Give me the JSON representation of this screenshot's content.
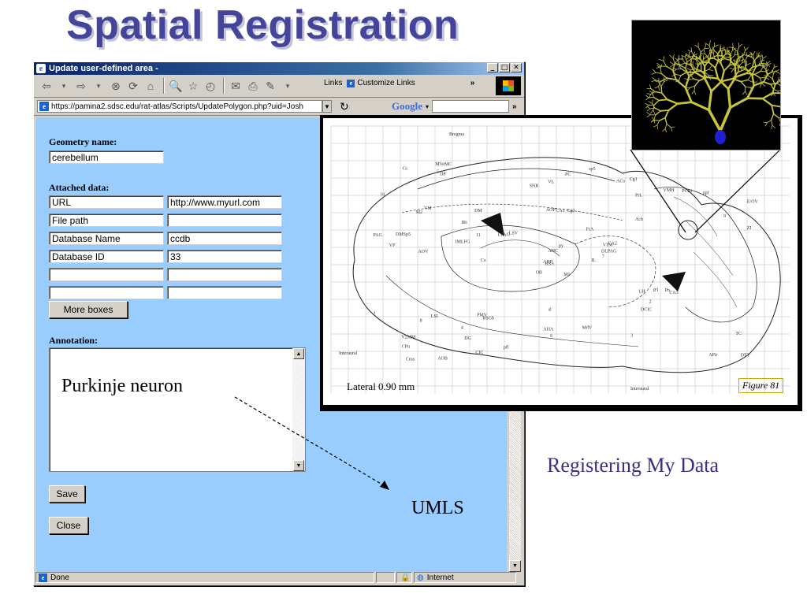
{
  "slide": {
    "title": "Spatial Registration",
    "registering_text": "Registering My Data",
    "umls_text": "UMLS",
    "annotation_overlay": "Purkinje neuron"
  },
  "window": {
    "title": "Update user-defined area -",
    "buttons": [
      "_",
      "□",
      "✕"
    ]
  },
  "toolbar": {
    "links_label": "Links",
    "customize_links": "Customize Links",
    "chevron": "»"
  },
  "address": {
    "url": "https://pamina2.sdsc.edu/rat-atlas/Scripts/UpdatePolygon.php?uid=Josh",
    "search_brand": "Google"
  },
  "form": {
    "geometry_label": "Geometry name:",
    "geometry_value": "cerebellum",
    "attached_label": "Attached data:",
    "rows": [
      {
        "key": "URL",
        "value": "http://www.myurl.com"
      },
      {
        "key": "File path",
        "value": ""
      },
      {
        "key": "Database Name",
        "value": "ccdb"
      },
      {
        "key": "Database ID",
        "value": "33"
      },
      {
        "key": "",
        "value": ""
      },
      {
        "key": "",
        "value": ""
      }
    ],
    "more_boxes": "More boxes",
    "annotation_label": "Annotation:",
    "save": "Save",
    "close": "Close"
  },
  "status": {
    "text": "Done",
    "zone": "Internet"
  },
  "atlas": {
    "lateral": "Lateral 0.90 mm",
    "figure": "Figure 81",
    "bregma": "Bregma",
    "interaural": "Interaural",
    "region_labels": [
      "M1",
      "M2",
      "RSA",
      "V2MM",
      "V1M",
      "RSGb",
      "Cg1",
      "Cg2",
      "PrL",
      "IL",
      "DP",
      "DTT",
      "AOV",
      "E/OV",
      "OB",
      "Acb",
      "AOB",
      "AOP",
      "FrA",
      "LSI",
      "LSV",
      "CPu",
      "DG",
      "CA1",
      "CA2",
      "CA3",
      "VM",
      "VL",
      "VP",
      "LH",
      "ZI",
      "AHP",
      "AHA",
      "AHC",
      "DM",
      "VMH",
      "PMV",
      "APir",
      "TC",
      "Pn",
      "sp5",
      "LPAG",
      "IMLFG",
      "DCIC",
      "CIC",
      "PAG",
      "DLPAG",
      "Crus",
      "6",
      "7",
      "8",
      "9",
      "10",
      "2",
      "3",
      "4",
      "5",
      "Gi",
      "MdV",
      "ppf",
      "PC",
      "Cx",
      "DMSp5",
      "IRt",
      "PCRt",
      "MVeMC",
      "ACo",
      "SNR",
      "py",
      "f",
      "sl",
      "pfl",
      "iFl",
      "11"
    ]
  },
  "colors": {
    "title": "#44449a",
    "form_bg": "#99ccff",
    "registering": "#3a2e8c",
    "neuron": "#c8c43c",
    "titlebar_start": "#0a246a",
    "titlebar_end": "#a6caf0"
  },
  "icons": [
    "ie-logo-icon",
    "back-icon",
    "forward-icon",
    "stop-icon",
    "refresh-icon",
    "home-icon",
    "search-icon",
    "favorites-icon",
    "history-icon",
    "mail-icon",
    "print-icon",
    "edit-icon",
    "go-icon",
    "lock-icon",
    "globe-icon",
    "windows-flag-icon"
  ]
}
